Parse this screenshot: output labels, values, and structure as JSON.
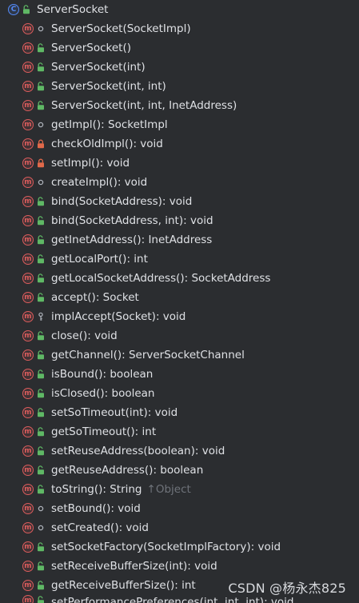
{
  "structure": {
    "class_name": "ServerSocket",
    "class_kind_letter": "C",
    "method_kind_letter": "m",
    "items": [
      {
        "label": "ServerSocket(SocketImpl)",
        "visibility": "package",
        "inherited_from": ""
      },
      {
        "label": "ServerSocket()",
        "visibility": "public",
        "inherited_from": ""
      },
      {
        "label": "ServerSocket(int)",
        "visibility": "public",
        "inherited_from": ""
      },
      {
        "label": "ServerSocket(int, int)",
        "visibility": "public",
        "inherited_from": ""
      },
      {
        "label": "ServerSocket(int, int, InetAddress)",
        "visibility": "public",
        "inherited_from": ""
      },
      {
        "label": "getImpl(): SocketImpl",
        "visibility": "package",
        "inherited_from": ""
      },
      {
        "label": "checkOldImpl(): void",
        "visibility": "private",
        "inherited_from": ""
      },
      {
        "label": "setImpl(): void",
        "visibility": "private",
        "inherited_from": ""
      },
      {
        "label": "createImpl(): void",
        "visibility": "package",
        "inherited_from": ""
      },
      {
        "label": "bind(SocketAddress): void",
        "visibility": "public",
        "inherited_from": ""
      },
      {
        "label": "bind(SocketAddress, int): void",
        "visibility": "public",
        "inherited_from": ""
      },
      {
        "label": "getInetAddress(): InetAddress",
        "visibility": "public",
        "inherited_from": ""
      },
      {
        "label": "getLocalPort(): int",
        "visibility": "public",
        "inherited_from": ""
      },
      {
        "label": "getLocalSocketAddress(): SocketAddress",
        "visibility": "public",
        "inherited_from": ""
      },
      {
        "label": "accept(): Socket",
        "visibility": "public",
        "inherited_from": ""
      },
      {
        "label": "implAccept(Socket): void",
        "visibility": "protected",
        "inherited_from": ""
      },
      {
        "label": "close(): void",
        "visibility": "public",
        "inherited_from": ""
      },
      {
        "label": "getChannel(): ServerSocketChannel",
        "visibility": "public",
        "inherited_from": ""
      },
      {
        "label": "isBound(): boolean",
        "visibility": "public",
        "inherited_from": ""
      },
      {
        "label": "isClosed(): boolean",
        "visibility": "public",
        "inherited_from": ""
      },
      {
        "label": "setSoTimeout(int): void",
        "visibility": "public",
        "inherited_from": ""
      },
      {
        "label": "getSoTimeout(): int",
        "visibility": "public",
        "inherited_from": ""
      },
      {
        "label": "setReuseAddress(boolean): void",
        "visibility": "public",
        "inherited_from": ""
      },
      {
        "label": "getReuseAddress(): boolean",
        "visibility": "public",
        "inherited_from": ""
      },
      {
        "label": "toString(): String",
        "visibility": "public",
        "inherited_from": "↑Object"
      },
      {
        "label": "setBound(): void",
        "visibility": "package",
        "inherited_from": ""
      },
      {
        "label": "setCreated(): void",
        "visibility": "package",
        "inherited_from": ""
      },
      {
        "label": "setSocketFactory(SocketImplFactory): void",
        "visibility": "public",
        "inherited_from": ""
      },
      {
        "label": "setReceiveBufferSize(int): void",
        "visibility": "public",
        "inherited_from": ""
      },
      {
        "label": "getReceiveBufferSize(): int",
        "visibility": "public",
        "inherited_from": ""
      },
      {
        "label": "setPerformancePreferences(int, int, int): void",
        "visibility": "public",
        "inherited_from": ""
      }
    ]
  },
  "watermark": "CSDN @杨永杰825",
  "colors": {
    "background": "#2b2d30",
    "text": "#dfe1e5",
    "muted_text": "#6f737a",
    "class_icon": "#548af7",
    "method_icon": "#db5c5c",
    "public_icon": "#5fb865",
    "private_icon": "#e0694a",
    "package_icon": "#aeb3bb",
    "protected_icon": "#aeb3bb"
  }
}
